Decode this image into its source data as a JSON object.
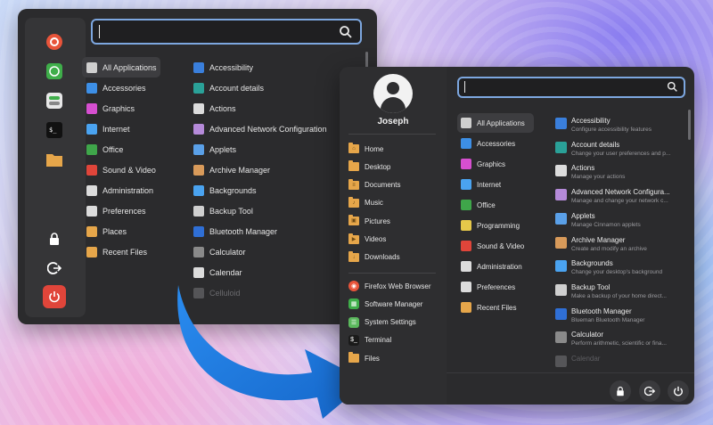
{
  "old_menu": {
    "categories": [
      {
        "label": "All Applications",
        "icon": "grid-icon",
        "selected": true,
        "color": "#cfcfcf"
      },
      {
        "label": "Accessories",
        "icon": "scissors-icon",
        "color": "#3d8fe6"
      },
      {
        "label": "Graphics",
        "icon": "graphics-icon",
        "color": "#d64fd0"
      },
      {
        "label": "Internet",
        "icon": "cloud-icon",
        "color": "#4aa3f0"
      },
      {
        "label": "Office",
        "icon": "office-icon",
        "color": "#3fa64a"
      },
      {
        "label": "Sound & Video",
        "icon": "play-icon",
        "color": "#e0453a"
      },
      {
        "label": "Administration",
        "icon": "admin-icon",
        "color": "#dcdcdc"
      },
      {
        "label": "Preferences",
        "icon": "toggle-icon",
        "color": "#dcdcdc"
      },
      {
        "label": "Places",
        "icon": "folder-icon",
        "color": "#e6a64a"
      },
      {
        "label": "Recent Files",
        "icon": "recent-icon",
        "color": "#e6a64a"
      }
    ],
    "apps": [
      {
        "label": "Accessibility",
        "icon": "accessibility-icon",
        "color": "#3a7fdc"
      },
      {
        "label": "Account details",
        "icon": "account-icon",
        "color": "#2aa198"
      },
      {
        "label": "Actions",
        "icon": "actions-icon",
        "color": "#dcdcdc"
      },
      {
        "label": "Advanced Network Configuration",
        "icon": "network-icon",
        "color": "#b58ad9"
      },
      {
        "label": "Applets",
        "icon": "applets-icon",
        "color": "#5aa0e8"
      },
      {
        "label": "Archive Manager",
        "icon": "archive-icon",
        "color": "#d89a5a"
      },
      {
        "label": "Backgrounds",
        "icon": "backgrounds-icon",
        "color": "#4aa3f0"
      },
      {
        "label": "Backup Tool",
        "icon": "backup-icon",
        "color": "#cfcfcf"
      },
      {
        "label": "Bluetooth Manager",
        "icon": "bluetooth-icon",
        "color": "#2f6fd6"
      },
      {
        "label": "Calculator",
        "icon": "calculator-icon",
        "color": "#8a8a8a"
      },
      {
        "label": "Calendar",
        "icon": "calendar-icon",
        "color": "#dcdcdc"
      },
      {
        "label": "Celluloid",
        "icon": "celluloid-icon",
        "color": "#555558",
        "faded": true
      }
    ],
    "favorites": [
      {
        "name": "firefox-icon",
        "color": "#e8543a",
        "glyph": "◉"
      },
      {
        "name": "software-manager-icon",
        "color": "#3fae4a",
        "glyph": "▦"
      },
      {
        "name": "settings-icon",
        "color": "#5bb85d",
        "glyph": "☰"
      },
      {
        "name": "terminal-icon",
        "color": "#1a1a1a",
        "glyph": "$_"
      },
      {
        "name": "files-icon",
        "color": "#e6a64a",
        "glyph": ""
      },
      {
        "name": "lock-icon",
        "color": "#2b2b2d",
        "glyph": "🔒"
      },
      {
        "name": "logout-icon",
        "color": "#2b2b2d",
        "glyph": "⟳"
      },
      {
        "name": "power-icon",
        "color": "#e0453a",
        "glyph": "⏻"
      }
    ]
  },
  "new_menu": {
    "user": {
      "name": "Joseph"
    },
    "places": [
      {
        "label": "Home",
        "glyph": "⌂"
      },
      {
        "label": "Desktop",
        "glyph": ""
      },
      {
        "label": "Documents",
        "glyph": "≡"
      },
      {
        "label": "Music",
        "glyph": "♪"
      },
      {
        "label": "Pictures",
        "glyph": "▣"
      },
      {
        "label": "Videos",
        "glyph": "▶"
      },
      {
        "label": "Downloads",
        "glyph": "↓"
      }
    ],
    "apps_favorites": [
      {
        "label": "Firefox Web Browser",
        "icon": "firefox-icon",
        "color": "#e8543a",
        "glyph": "◉"
      },
      {
        "label": "Software Manager",
        "icon": "software-manager-icon",
        "color": "#3fae4a",
        "glyph": "▦"
      },
      {
        "label": "System Settings",
        "icon": "settings-icon",
        "color": "#5bb85d",
        "glyph": "☰"
      },
      {
        "label": "Terminal",
        "icon": "terminal-icon",
        "color": "#1a1a1a",
        "glyph": "$_"
      },
      {
        "label": "Files",
        "icon": "files-icon",
        "color": "#e6a64a",
        "glyph": ""
      }
    ],
    "categories": [
      {
        "label": "All Applications",
        "icon": "grid-icon",
        "selected": true,
        "color": "#cfcfcf"
      },
      {
        "label": "Accessories",
        "icon": "scissors-icon",
        "color": "#3d8fe6"
      },
      {
        "label": "Graphics",
        "icon": "graphics-icon",
        "color": "#d64fd0"
      },
      {
        "label": "Internet",
        "icon": "cloud-icon",
        "color": "#4aa3f0"
      },
      {
        "label": "Office",
        "icon": "office-icon",
        "color": "#3fa64a"
      },
      {
        "label": "Programming",
        "icon": "programming-icon",
        "color": "#e6c84a"
      },
      {
        "label": "Sound & Video",
        "icon": "play-icon",
        "color": "#e0453a"
      },
      {
        "label": "Administration",
        "icon": "admin-icon",
        "color": "#dcdcdc"
      },
      {
        "label": "Preferences",
        "icon": "toggle-icon",
        "color": "#dcdcdc"
      },
      {
        "label": "Recent Files",
        "icon": "recent-icon",
        "color": "#e6a64a"
      }
    ],
    "apps": [
      {
        "label": "Accessibility",
        "desc": "Configure accessibility features",
        "icon": "accessibility-icon",
        "color": "#3a7fdc"
      },
      {
        "label": "Account details",
        "desc": "Change your user preferences and p...",
        "icon": "account-icon",
        "color": "#2aa198"
      },
      {
        "label": "Actions",
        "desc": "Manage your actions",
        "icon": "actions-icon",
        "color": "#dcdcdc"
      },
      {
        "label": "Advanced Network Configura...",
        "desc": "Manage and change your network c...",
        "icon": "network-icon",
        "color": "#b58ad9"
      },
      {
        "label": "Applets",
        "desc": "Manage Cinnamon applets",
        "icon": "applets-icon",
        "color": "#5aa0e8"
      },
      {
        "label": "Archive Manager",
        "desc": "Create and modify an archive",
        "icon": "archive-icon",
        "color": "#d89a5a"
      },
      {
        "label": "Backgrounds",
        "desc": "Change your desktop's background",
        "icon": "backgrounds-icon",
        "color": "#4aa3f0"
      },
      {
        "label": "Backup Tool",
        "desc": "Make a backup of your home direct...",
        "icon": "backup-icon",
        "color": "#cfcfcf"
      },
      {
        "label": "Bluetooth Manager",
        "desc": "Blueman Bluetooth Manager",
        "icon": "bluetooth-icon",
        "color": "#2f6fd6"
      },
      {
        "label": "Calculator",
        "desc": "Perform arithmetic, scientific or fina...",
        "icon": "calculator-icon",
        "color": "#8a8a8a"
      },
      {
        "label": "Calendar",
        "desc": "",
        "icon": "calendar-icon",
        "color": "#555558",
        "faded": true
      }
    ]
  },
  "colors": {
    "accent": "#7da7e0",
    "arrow": "#1f7fe0",
    "panel": "#2b2b2d"
  }
}
